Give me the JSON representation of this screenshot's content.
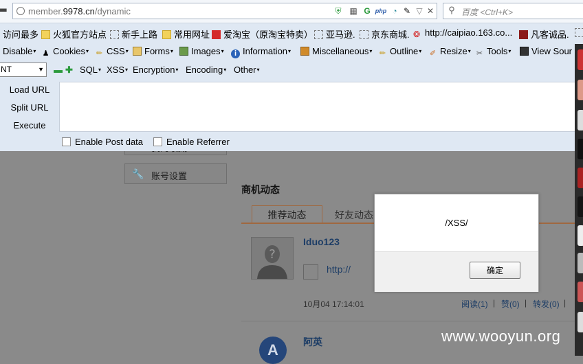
{
  "browser": {
    "url_host_prefix": "member.",
    "url_host": "9978.cn",
    "url_path": "/dynamic",
    "search_placeholder": "百度 <Ctrl+K>"
  },
  "bookmarks": [
    "访问最多",
    "火狐官方站点",
    "新手上路",
    "常用网址",
    "爱淘宝（原淘宝特卖）",
    "亚马逊.",
    "京东商城.",
    "http://caipiao.163.co...",
    "凡客诚品."
  ],
  "webdev_toolbar": [
    "Disable",
    "Cookies",
    "CSS",
    "Forms",
    "Images",
    "Information",
    "Miscellaneous",
    "Outline",
    "Resize",
    "Tools",
    "View Sour"
  ],
  "hackbar": {
    "select_value": "NT",
    "menus": [
      "SQL",
      "XSS",
      "Encryption",
      "Encoding",
      "Other"
    ],
    "load_url": "Load URL",
    "split_url": "Split URL",
    "execute": "Execute",
    "enable_post": "Enable Post data",
    "enable_referrer": "Enable Referrer"
  },
  "page": {
    "menu_item_1": "我的收藏",
    "menu_item_2": "账号设置",
    "section_title": "商机动态",
    "tab_recommended": "推荐动态",
    "tab_friends": "好友动态",
    "post1": {
      "user": "Iduo123",
      "link": "http://",
      "time": "10月04 17:14:01",
      "read": "阅读(1)",
      "like": "赞(0)",
      "forward": "转发(0)",
      "extra": "|"
    },
    "post2": {
      "user": "阿英",
      "avatar_letter": "A"
    }
  },
  "alert": {
    "message": "/XSS/",
    "ok": "确定"
  },
  "watermark": "www.wooyun.org"
}
